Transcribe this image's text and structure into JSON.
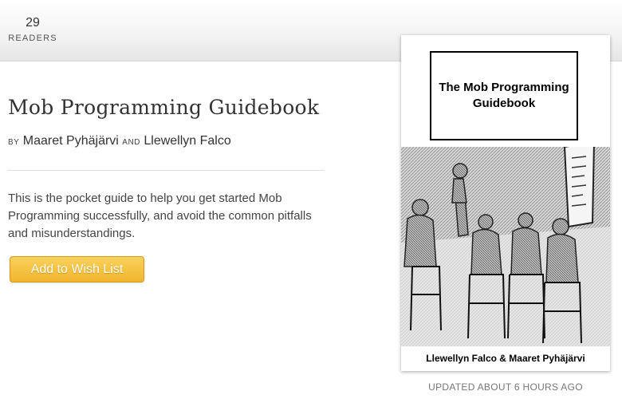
{
  "header": {
    "readers_count": "29",
    "readers_label": "READERS"
  },
  "book": {
    "title": "Mob Programming Guidebook",
    "by_word": "BY",
    "and_word": "AND",
    "authors": [
      "Maaret Pyhäjärvi",
      "Llewellyn Falco"
    ],
    "description": "This is the pocket guide to help you get started Mob Programming successfully, and avoid the common pitfalls and misunderstandings.",
    "wishlist_label": "Add to Wish List"
  },
  "cover": {
    "title": "The Mob Programming Guidebook",
    "authors": "Llewellyn Falco & Maaret Pyhäjärvi"
  },
  "updated": "UPDATED ABOUT 6 HOURS AGO",
  "colors": {
    "button": "#f5c242",
    "text": "#333333",
    "muted": "#777777"
  }
}
